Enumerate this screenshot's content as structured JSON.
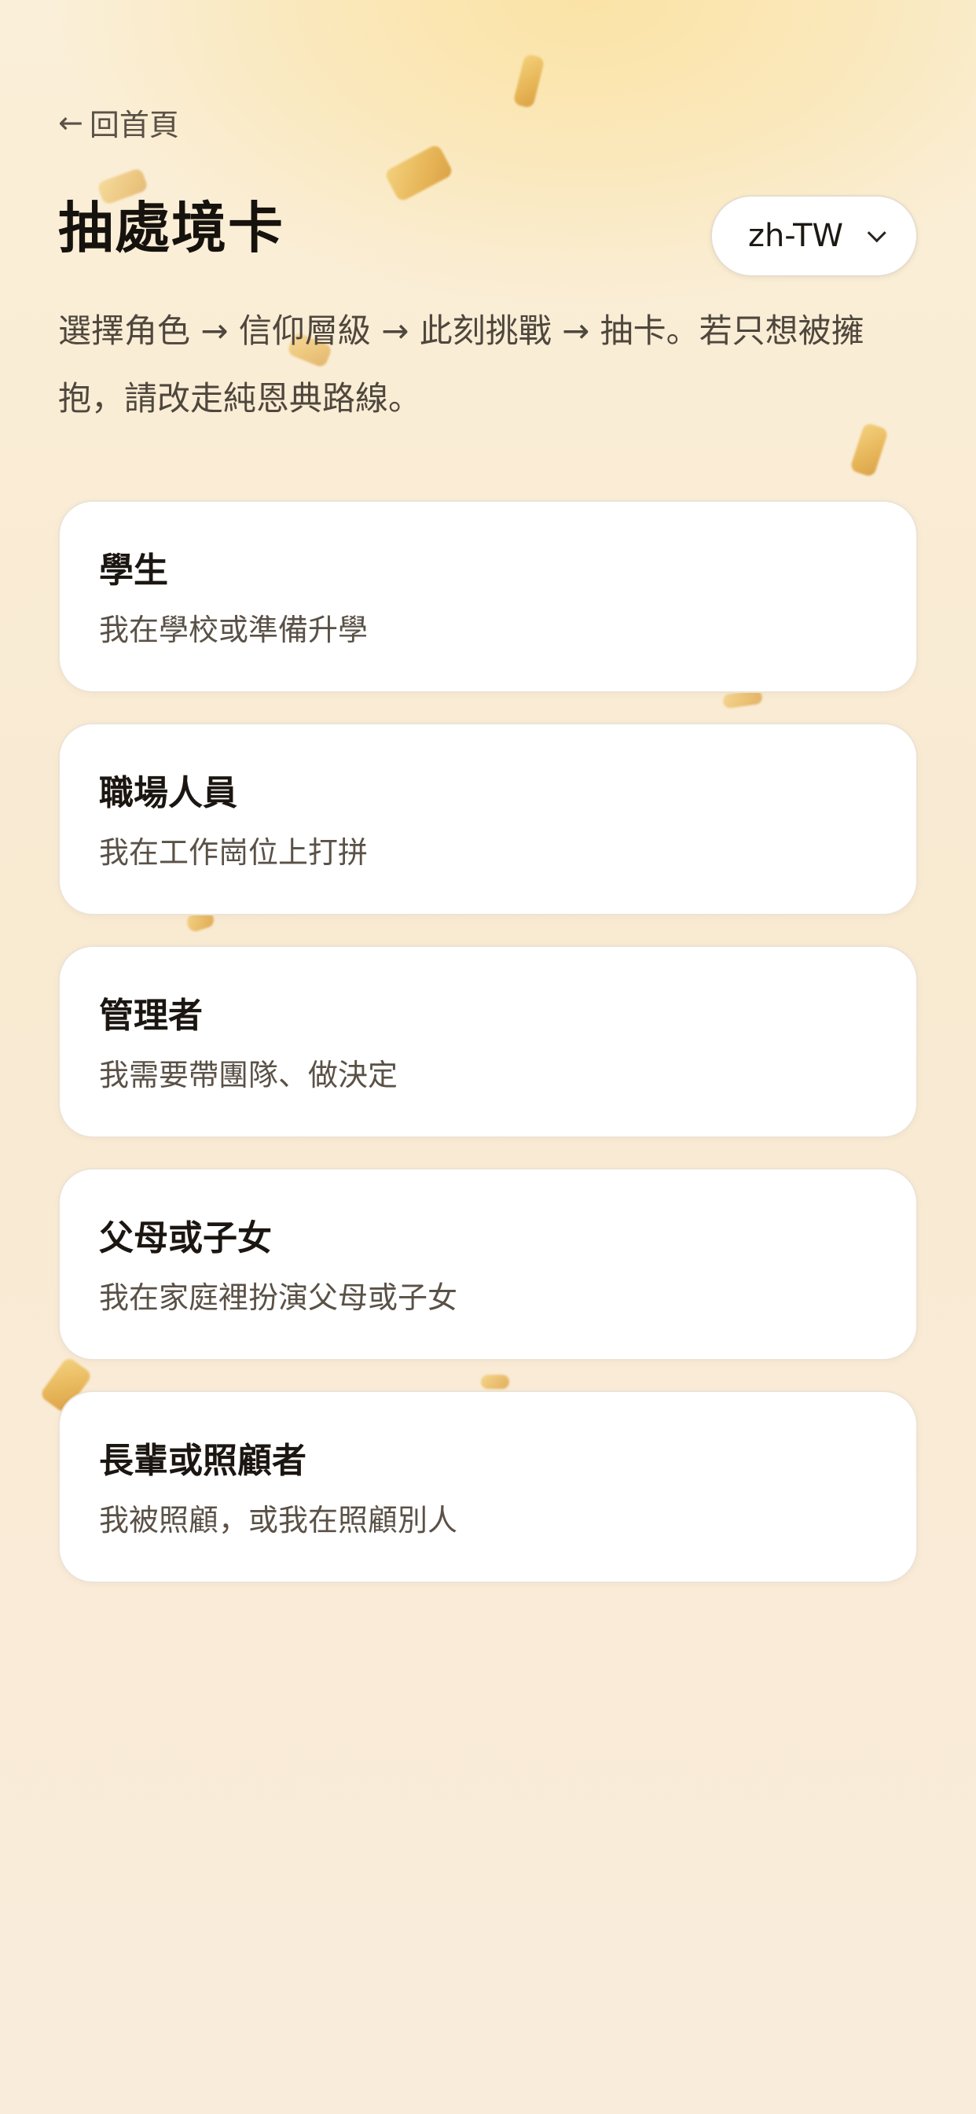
{
  "nav": {
    "back_arrow": "←",
    "back_label": "回首頁"
  },
  "header": {
    "title": "抽處境卡",
    "language": {
      "selected": "zh-TW",
      "icon": "chevron-down-icon"
    }
  },
  "intro": {
    "text": "選擇角色 → 信仰層級 → 此刻挑戰 → 抽卡。若只想被擁抱，請改走純恩典路線。"
  },
  "roles": [
    {
      "title": "學生",
      "description": "我在學校或準備升學"
    },
    {
      "title": "職場人員",
      "description": "我在工作崗位上打拼"
    },
    {
      "title": "管理者",
      "description": "我需要帶團隊、做決定"
    },
    {
      "title": "父母或子女",
      "description": "我在家庭裡扮演父母或子女"
    },
    {
      "title": "長輩或照顧者",
      "description": "我被照顧，或我在照顧別人"
    }
  ],
  "colors": {
    "background": "#f9ecd8",
    "accent_glow": "#fbe3a6",
    "confetti": "#e5b04c",
    "card": "#ffffff",
    "text_primary": "#1b1611",
    "text_secondary": "#5a5147"
  }
}
